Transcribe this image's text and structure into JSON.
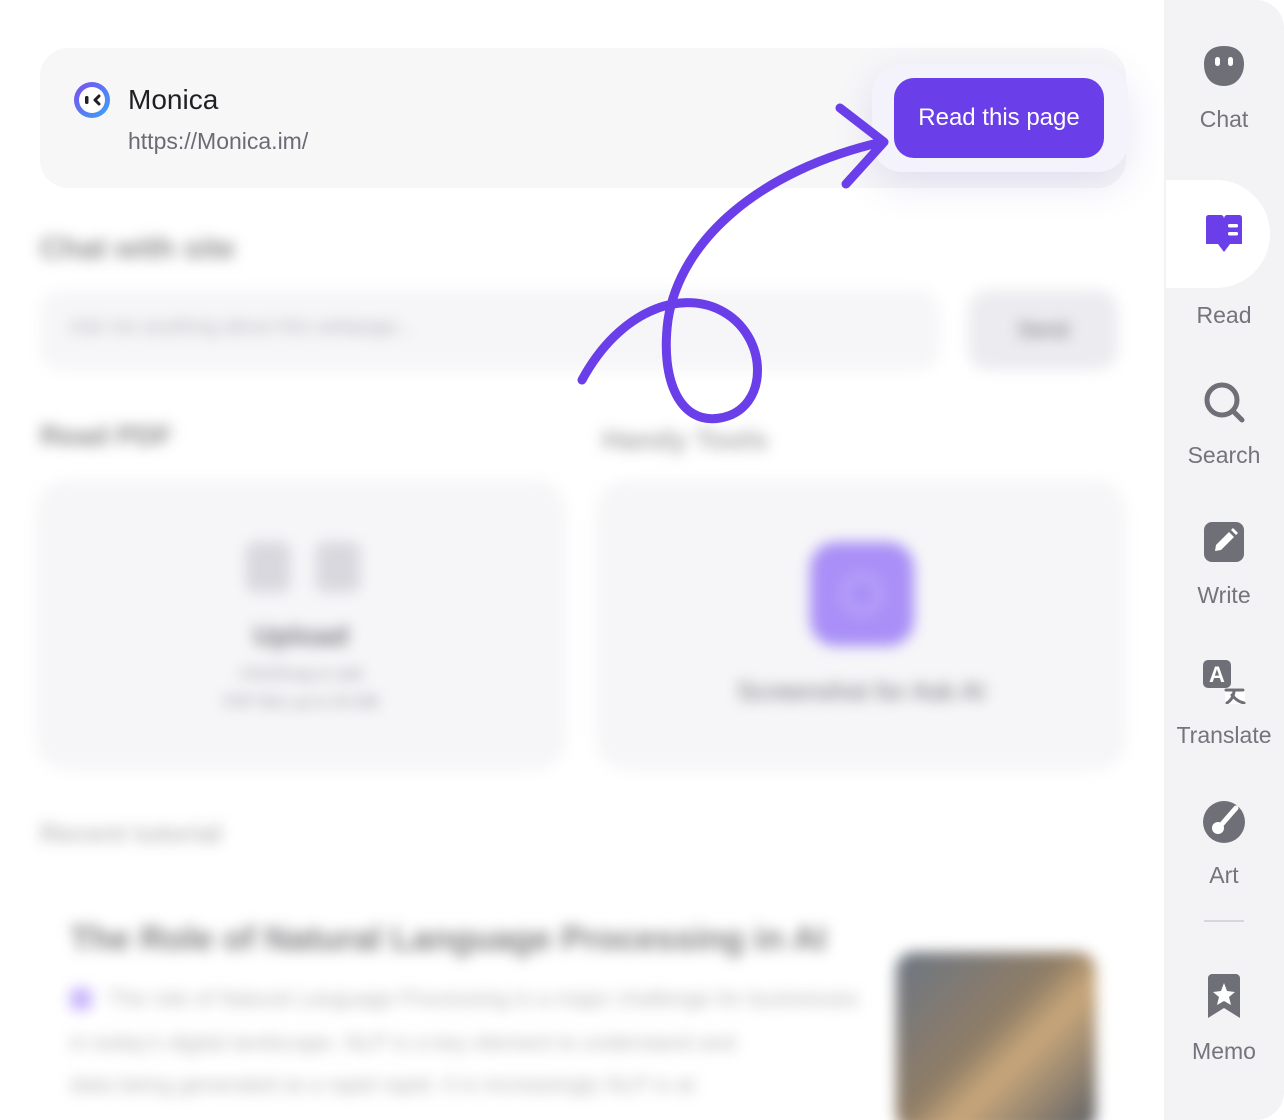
{
  "site": {
    "name": "Monica",
    "url": "https://Monica.im/",
    "read_button": "Read this page"
  },
  "background": {
    "chat_title": "Chat with site",
    "chat_placeholder": "Ask me anything about this webpage...",
    "send_label": "Send",
    "read_pdf_title": "Read PDF",
    "handy_tools_title": "Handy Tools",
    "upload_label": "Upload",
    "upload_sub_1": "Click/Drag to add",
    "upload_sub_2": "PDF files up to 50 MB",
    "tool_label": "Screenshot for Ask AI",
    "recent_title": "Recent tutorial",
    "article_title": "The Role of Natural Language Processing in AI",
    "article_line_1": "The role of Natural Language Processing is a major challenge for businesses",
    "article_line_2": "in today's digital landscape. NLP is a key element to understand and",
    "article_line_3": "data being generated at a rapid rapid. It is increasingly NLP is at"
  },
  "sidebar": {
    "items": [
      {
        "label": "Chat",
        "icon": "chat-bot-icon"
      },
      {
        "label": "Read",
        "icon": "read-book-icon",
        "active": true
      },
      {
        "label": "Search",
        "icon": "search-icon"
      },
      {
        "label": "Write",
        "icon": "write-pencil-icon"
      },
      {
        "label": "Translate",
        "icon": "translate-icon"
      },
      {
        "label": "Art",
        "icon": "art-palette-icon"
      },
      {
        "label": "Memo",
        "icon": "memo-bookmark-icon"
      }
    ]
  },
  "colors": {
    "accent": "#6a3ee8",
    "sidebar_bg": "#f3f3f5",
    "icon_gray": "#6f6f77"
  }
}
